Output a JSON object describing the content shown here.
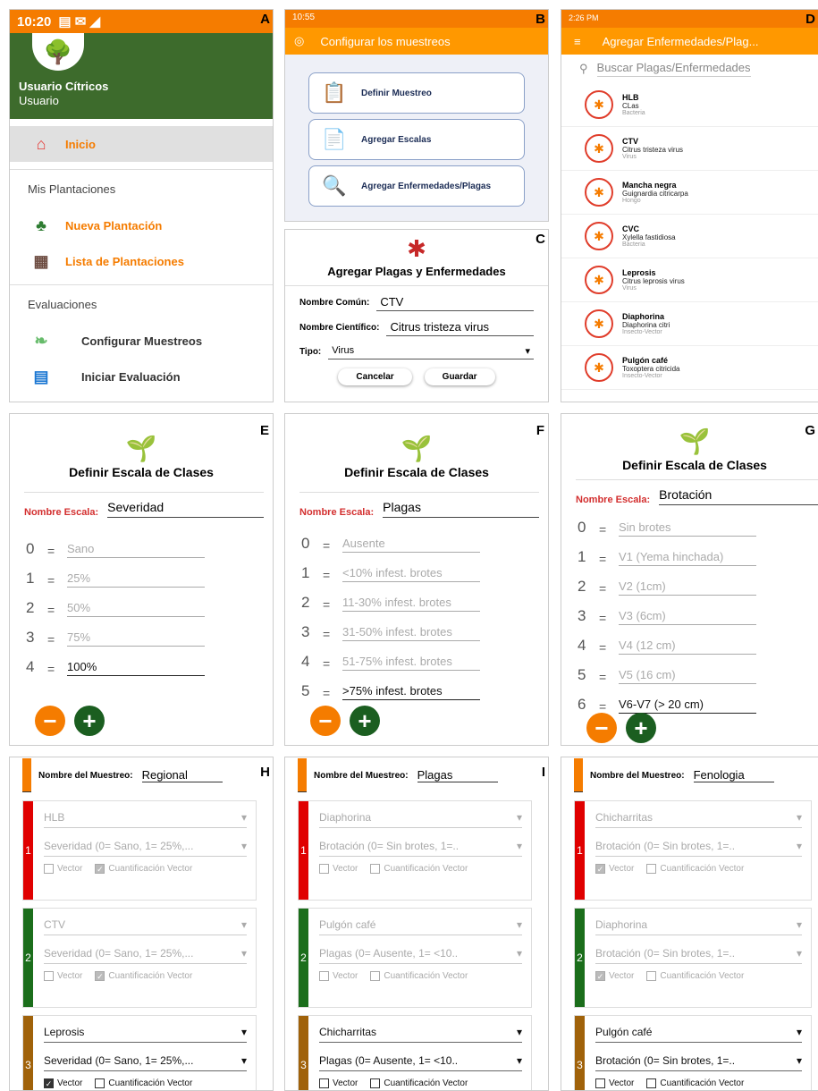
{
  "labels": {
    "a": "A",
    "b": "B",
    "c": "C",
    "d": "D",
    "e": "E",
    "f": "F",
    "g": "G",
    "h": "H",
    "i": "I"
  },
  "panelA": {
    "time": "10:20",
    "user_name": "Usuario Cítricos",
    "user_role": "Usuario",
    "home": "Inicio",
    "section_plantations": "Mis Plantaciones",
    "new_plantation": "Nueva Plantación",
    "list_plantations": "Lista de Plantaciones",
    "section_evaluations": "Evaluaciones",
    "config_sampling": "Configurar Muestreos",
    "start_evaluation": "Iniciar Evaluación"
  },
  "panelB": {
    "time": "10:55",
    "title": "Configurar los muestreos",
    "btn_define": "Definir Muestreo",
    "btn_scales": "Agregar Escalas",
    "btn_diseases": "Agregar Enfermedades/Plagas"
  },
  "panelC": {
    "title": "Agregar Plagas y Enfermedades",
    "common_label": "Nombre Común:",
    "common_value": "CTV",
    "sci_label": "Nombre Científico:",
    "sci_value": "Citrus tristeza virus",
    "type_label": "Tipo:",
    "type_value": "Virus",
    "cancel": "Cancelar",
    "save": "Guardar"
  },
  "panelD": {
    "time": "2:26 PM",
    "title": "Agregar Enfermedades/Plag...",
    "search_placeholder": "Buscar Plagas/Enfermedades",
    "items": [
      {
        "name": "HLB",
        "sci": "CLas",
        "type": "Bacteria"
      },
      {
        "name": "CTV",
        "sci": "Citrus tristeza virus",
        "type": "Virus"
      },
      {
        "name": "Mancha negra",
        "sci": "Guignardia citricarpa",
        "type": "Hongo"
      },
      {
        "name": "CVC",
        "sci": "Xylella fastidiosa",
        "type": "Bacteria"
      },
      {
        "name": "Leprosis",
        "sci": "Citrus leprosis virus",
        "type": "Virus"
      },
      {
        "name": "Diaphorina",
        "sci": "Diaphorina citri",
        "type": "Insecto-Vector"
      },
      {
        "name": "Pulgón café",
        "sci": "Toxoptera citricida",
        "type": "Insecto-Vector"
      }
    ]
  },
  "scale_common": {
    "title": "Definir Escala de Clases",
    "name_label": "Nombre Escala:"
  },
  "panelE": {
    "name": "Severidad",
    "rows": [
      {
        "k": "0",
        "v": "Sano"
      },
      {
        "k": "1",
        "v": "25%"
      },
      {
        "k": "2",
        "v": "50%"
      },
      {
        "k": "3",
        "v": "75%"
      },
      {
        "k": "4",
        "v": "100%"
      }
    ]
  },
  "panelF": {
    "name": "Plagas",
    "rows": [
      {
        "k": "0",
        "v": "Ausente"
      },
      {
        "k": "1",
        "v": "<10% infest. brotes"
      },
      {
        "k": "2",
        "v": "11-30% infest. brotes"
      },
      {
        "k": "3",
        "v": "31-50% infest. brotes"
      },
      {
        "k": "4",
        "v": "51-75% infest. brotes"
      },
      {
        "k": "5",
        "v": ">75% infest. brotes"
      }
    ]
  },
  "panelG": {
    "name": "Brotación",
    "rows": [
      {
        "k": "0",
        "v": "Sin brotes"
      },
      {
        "k": "1",
        "v": "V1 (Yema hinchada)"
      },
      {
        "k": "2",
        "v": "V2 (1cm)"
      },
      {
        "k": "3",
        "v": "V3 (6cm)"
      },
      {
        "k": "4",
        "v": "V4 (12 cm)"
      },
      {
        "k": "5",
        "v": "V5 (16 cm)"
      },
      {
        "k": "6",
        "v": "V6-V7 (> 20 cm)"
      }
    ]
  },
  "sampling_common": {
    "name_label": "Nombre del Muestreo:",
    "vector": "Vector",
    "quant": "Cuantificación Vector"
  },
  "panelH": {
    "name": "Regional",
    "groups": [
      {
        "n": "1",
        "pest": "HLB",
        "scale": "Severidad (0= Sano, 1= 25%,..."
      },
      {
        "n": "2",
        "pest": "CTV",
        "scale": "Severidad (0= Sano, 1= 25%,..."
      },
      {
        "n": "3",
        "pest": "Leprosis",
        "scale": "Severidad (0= Sano, 1= 25%,..."
      }
    ]
  },
  "panelI": {
    "name": "Plagas",
    "groups": [
      {
        "n": "1",
        "pest": "Diaphorina",
        "scale": "Brotación (0= Sin brotes, 1=.."
      },
      {
        "n": "2",
        "pest": "Pulgón café",
        "scale": "Plagas (0= Ausente, 1= <10.."
      },
      {
        "n": "3",
        "pest": "Chicharritas",
        "scale": "Plagas (0= Ausente, 1= <10.."
      }
    ]
  },
  "panelJ": {
    "name": "Fenologia",
    "groups": [
      {
        "n": "1",
        "pest": "Chicharritas",
        "scale": "Brotación (0= Sin brotes, 1=.."
      },
      {
        "n": "2",
        "pest": "Diaphorina",
        "scale": "Brotación (0= Sin brotes, 1=.."
      },
      {
        "n": "3",
        "pest": "Pulgón café",
        "scale": "Brotación (0= Sin brotes, 1=.."
      }
    ]
  },
  "colors": {
    "orange": "#f57c00",
    "green": "#3d6b2c",
    "red": "#d32f2f",
    "stripe1": "#e00000",
    "stripe2": "#1b6e1b",
    "stripe3": "#a0620a"
  }
}
